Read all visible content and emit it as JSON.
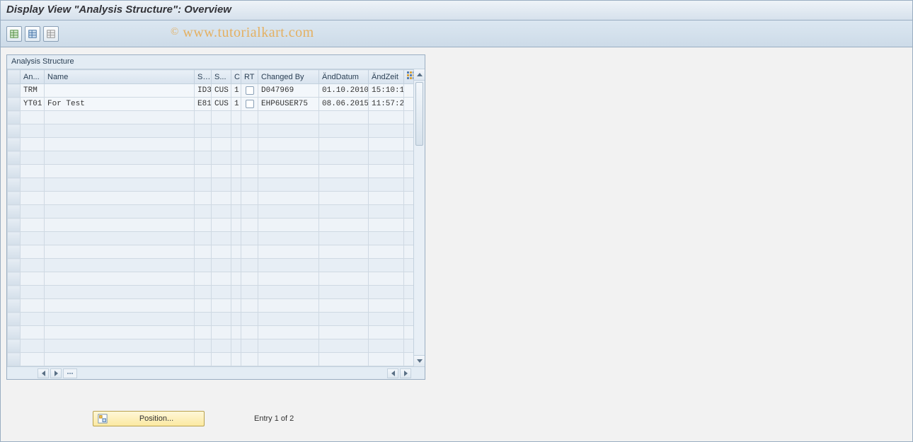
{
  "header": {
    "title": "Display View \"Analysis Structure\": Overview"
  },
  "watermark": "© www.tutorialkart.com",
  "panel": {
    "title": "Analysis Structure"
  },
  "columns": {
    "sel": "",
    "an": "An...",
    "name": "Name",
    "s1": "S...",
    "s2": "S...",
    "c": "C",
    "rt": "RT",
    "changed_by": "Changed By",
    "and_datum": "ÄndDatum",
    "and_zeit": "ÄndZeit"
  },
  "rows": [
    {
      "an": "TRM",
      "name": "",
      "s1": "ID3",
      "s2": "CUS",
      "c": "1",
      "rt": false,
      "changed_by": "D047969",
      "and_datum": "01.10.2010",
      "and_zeit": "15:10:1"
    },
    {
      "an": "YT01",
      "name": "For Test",
      "s1": "E81",
      "s2": "CUS",
      "c": "1",
      "rt": false,
      "changed_by": "EHP6USER75",
      "and_datum": "08.06.2015",
      "and_zeit": "11:57:2"
    }
  ],
  "empty_rows": 19,
  "footer": {
    "position_label": "Position...",
    "entry_text": "Entry 1 of 2"
  }
}
